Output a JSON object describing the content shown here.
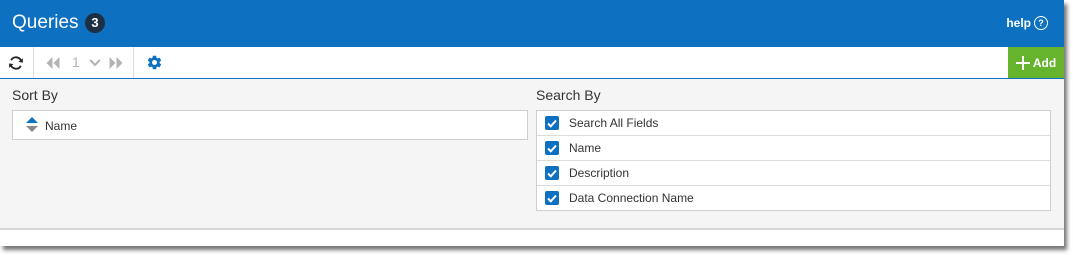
{
  "header": {
    "title": "Queries",
    "count": "3",
    "help_label": "help",
    "help_icon_glyph": "?"
  },
  "toolbar": {
    "refresh_icon": "refresh-icon",
    "first_page_icon": "double-chevron-left-icon",
    "page_number": "1",
    "page_dropdown_icon": "chevron-down-icon",
    "last_page_icon": "double-chevron-right-icon",
    "settings_icon": "gear-icon",
    "add_label": "Add"
  },
  "sort": {
    "label": "Sort By",
    "items": [
      {
        "label": "Name"
      }
    ]
  },
  "search": {
    "label": "Search By",
    "items": [
      {
        "label": "Search All Fields",
        "checked": true
      },
      {
        "label": "Name",
        "checked": true
      },
      {
        "label": "Description",
        "checked": true
      },
      {
        "label": "Data Connection Name",
        "checked": true
      }
    ]
  },
  "colors": {
    "header_bg": "#0d70c0",
    "count_badge_bg": "#1c2f45",
    "add_button_bg": "#66b32e",
    "checkbox": "#0d70c0",
    "content_bg": "#f5f5f5"
  }
}
